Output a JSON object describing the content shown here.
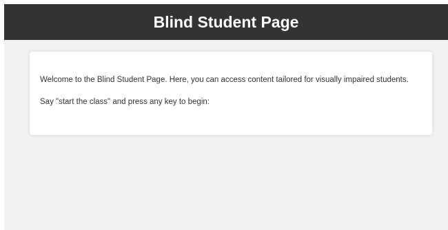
{
  "header": {
    "title": "Blind Student Page"
  },
  "content": {
    "welcome_text": "Welcome to the Blind Student Page. Here, you can access content tailored for visually impaired students.",
    "instruction_text": "Say \"start the class\" and press any key to begin:"
  },
  "colors": {
    "header_background": "#333333",
    "page_background": "#f2f2f2",
    "card_background": "#ffffff"
  }
}
